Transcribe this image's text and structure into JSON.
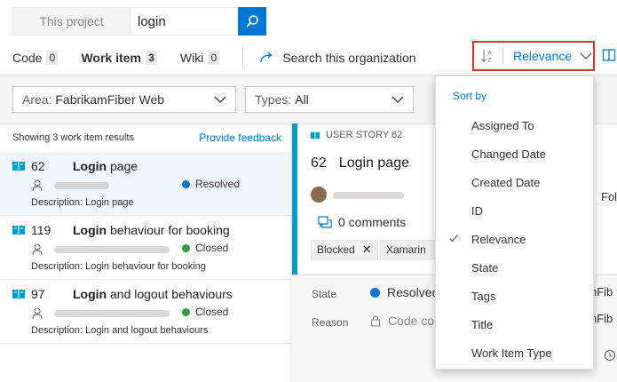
{
  "search": {
    "scope": "This project",
    "query": "login"
  },
  "tabs": [
    {
      "label": "Code",
      "count": "0"
    },
    {
      "label": "Work item",
      "count": "3"
    },
    {
      "label": "Wiki",
      "count": "0"
    }
  ],
  "org_search_label": "Search this organization",
  "sort": {
    "label": "Relevance"
  },
  "filters": {
    "area_key": "Area:",
    "area_value": "FabrikamFiber Web",
    "types_key": "Types:",
    "types_value": "All"
  },
  "results": {
    "summary": "Showing 3 work item results",
    "feedback_link": "Provide feedback",
    "items": [
      {
        "id": "62",
        "title_bold": "Login",
        "title_rest": " page",
        "status": "Resolved",
        "status_color": "#0078d4",
        "description": "Description: Login page"
      },
      {
        "id": "119",
        "title_bold": "Login",
        "title_rest": " behaviour for booking",
        "status": "Closed",
        "status_color": "#339947",
        "description": "Description: Login behaviour for booking"
      },
      {
        "id": "97",
        "title_bold": "Login",
        "title_rest": " and logout behaviours",
        "status": "Closed",
        "status_color": "#339947",
        "description": "Description: Login and logout behaviours"
      }
    ]
  },
  "detail": {
    "type": "USER STORY 62",
    "id": "62",
    "title": "Login page",
    "comments": "0 comments",
    "tags": [
      "Blocked",
      "Xamarin"
    ],
    "state_label": "State",
    "state_value": "Resolved",
    "reason_label": "Reason",
    "reason_value": "Code com",
    "follow_clipped": "Foll",
    "area_clipped_1": "nFib",
    "area_clipped_2": "nFib"
  },
  "sort_menu": {
    "header": "Sort by",
    "items": [
      "Assigned To",
      "Changed Date",
      "Created Date",
      "ID",
      "Relevance",
      "State",
      "Tags",
      "Title",
      "Work Item Type"
    ],
    "selected": "Relevance"
  },
  "colors": {
    "accent": "#0078d4",
    "highlight_border": "#d9342b",
    "story_bar": "#009ccc"
  }
}
